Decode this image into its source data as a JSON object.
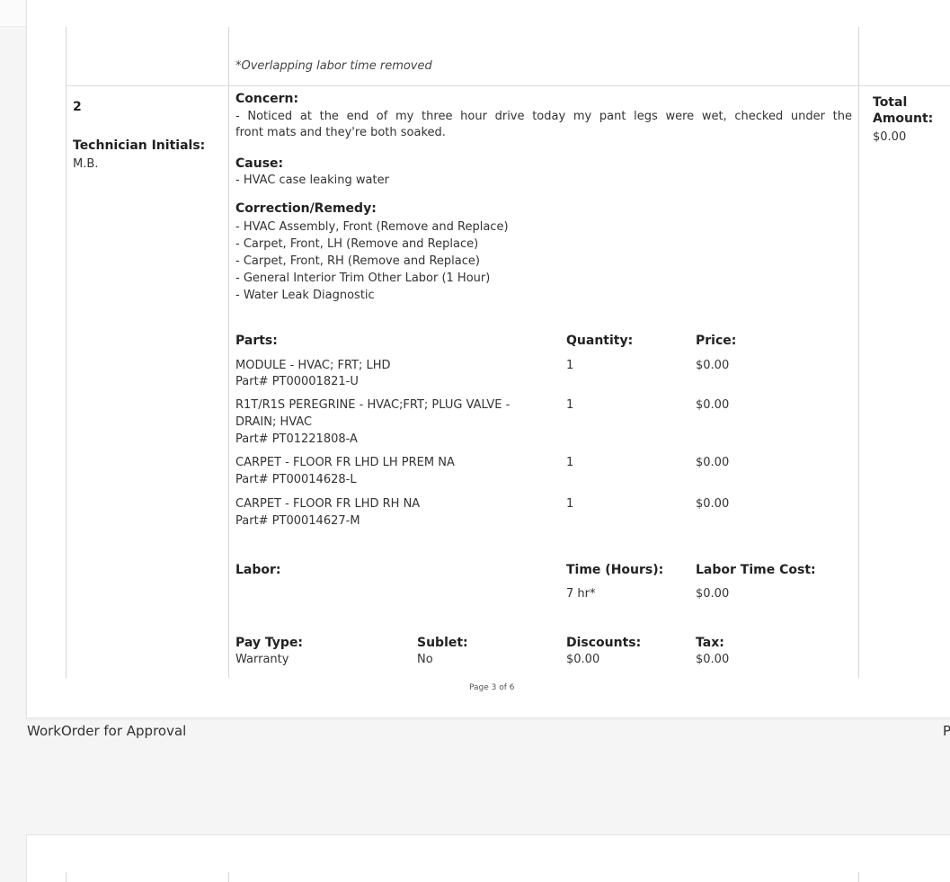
{
  "note": "*Overlapping labor time removed",
  "line_item": {
    "number": "2",
    "technician_label": "Technician Initials:",
    "technician_value": "M.B.",
    "total_label_line1": "Total",
    "total_label_line2": "Amount:",
    "total_value": "$0.00"
  },
  "concern": {
    "label": "Concern:",
    "line1": "- Noticed at the end of my three hour drive today my pant legs were wet, checked under the",
    "line2": "front mats and they're both soaked."
  },
  "cause": {
    "label": "Cause:",
    "text": "- HVAC case leaking water"
  },
  "correction": {
    "label": "Correction/Remedy:",
    "items": [
      "- HVAC Assembly, Front (Remove and Replace)",
      "- Carpet, Front, LH (Remove and Replace)",
      "- Carpet, Front, RH (Remove and Replace)",
      "- General Interior Trim Other Labor (1 Hour)",
      "- Water Leak Diagnostic"
    ]
  },
  "parts": {
    "header": "Parts:",
    "qty_header": "Quantity:",
    "price_header": "Price:",
    "rows": [
      {
        "line1": "MODULE - HVAC; FRT; LHD",
        "line2": "Part# PT00001821-U",
        "line3": "",
        "qty": "1",
        "price": "$0.00"
      },
      {
        "line1": "R1T/R1S PEREGRINE - HVAC;FRT; PLUG VALVE -",
        "line2": "DRAIN; HVAC",
        "line3": "Part# PT01221808-A",
        "qty": "1",
        "price": "$0.00"
      },
      {
        "line1": "CARPET - FLOOR FR LHD LH PREM NA",
        "line2": "Part# PT00014628-L",
        "line3": "",
        "qty": "1",
        "price": "$0.00"
      },
      {
        "line1": "CARPET - FLOOR FR LHD RH NA",
        "line2": "Part# PT00014627-M",
        "line3": "",
        "qty": "1",
        "price": "$0.00"
      }
    ]
  },
  "labor": {
    "header": "Labor:",
    "time_header": "Time (Hours):",
    "cost_header": "Labor Time Cost:",
    "time_value": "7 hr*",
    "cost_value": "$0.00"
  },
  "summary": {
    "pay_type_label": "Pay Type:",
    "pay_type_value": "Warranty",
    "sublet_label": "Sublet:",
    "sublet_value": "No",
    "discounts_label": "Discounts:",
    "discounts_value": "$0.00",
    "tax_label": "Tax:",
    "tax_value": "$0.00"
  },
  "footer": {
    "page": "Page 3 of 6",
    "doc_title": "WorkOrder for Approval",
    "right_fragment": "P"
  }
}
